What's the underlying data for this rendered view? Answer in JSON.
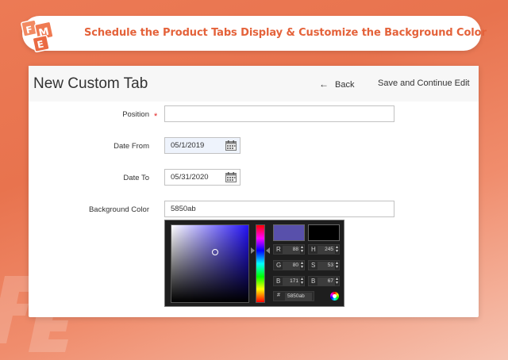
{
  "banner": {
    "title": "Schedule the Product Tabs Display & Customize the Background Color",
    "logo_icon": "fme-logo-icon",
    "accent": "#e4623a"
  },
  "header": {
    "title": "New Custom Tab",
    "back_label": "Back",
    "back_icon": "arrow-left-icon",
    "save_label": "Save and Continue Edit"
  },
  "form": {
    "position": {
      "label": "Position",
      "required_mark": "*",
      "value": ""
    },
    "date_from": {
      "label": "Date From",
      "value": "05/1/2019",
      "icon": "calendar-icon"
    },
    "date_to": {
      "label": "Date To",
      "value": "05/31/2020",
      "icon": "calendar-icon"
    },
    "background_color": {
      "label": "Background Color",
      "value": "5850ab"
    }
  },
  "color_picker": {
    "new_color": "#5850ab",
    "current_color": "#000000",
    "hue_accent": "#2412f5",
    "fields": {
      "r": {
        "label": "R",
        "value": "88"
      },
      "g": {
        "label": "G",
        "value": "80"
      },
      "b": {
        "label": "B",
        "value": "171"
      },
      "h": {
        "label": "H",
        "value": "245"
      },
      "s": {
        "label": "S",
        "value": "53"
      },
      "bv": {
        "label": "B",
        "value": "67"
      }
    },
    "hex": {
      "label": "#",
      "value": "5850ab"
    },
    "submit_icon": "color-wheel-icon"
  }
}
